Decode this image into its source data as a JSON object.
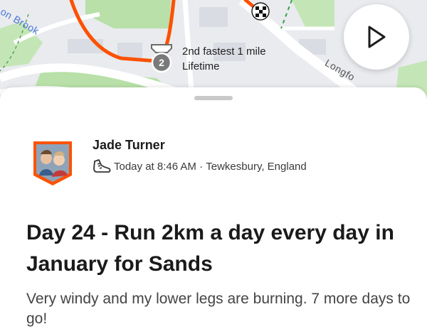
{
  "map": {
    "street_label_brook": "on Brook",
    "street_label_road": "Longfo",
    "achievement": {
      "line1": "2nd fastest 1 mile",
      "line2": "Lifetime",
      "badge_number": "2"
    },
    "colors": {
      "route": "#fc5200",
      "park": "#b5dfa5",
      "road": "#ffffff",
      "building": "#d9dce2"
    }
  },
  "activity": {
    "athlete_name": "Jade Turner",
    "timestamp": "Today at 8:46 AM",
    "separator": " · ",
    "location": "Tewkesbury, England",
    "title": "Day 24 - Run 2km a day every day in January for Sands",
    "description": "Very windy and my lower legs are burning. 7 more days to go!",
    "sport_icon": "shoe-icon"
  },
  "controls": {
    "play_icon": "play-icon"
  },
  "colors": {
    "accent": "#fc5200",
    "avatar_border": "#fc5200"
  }
}
